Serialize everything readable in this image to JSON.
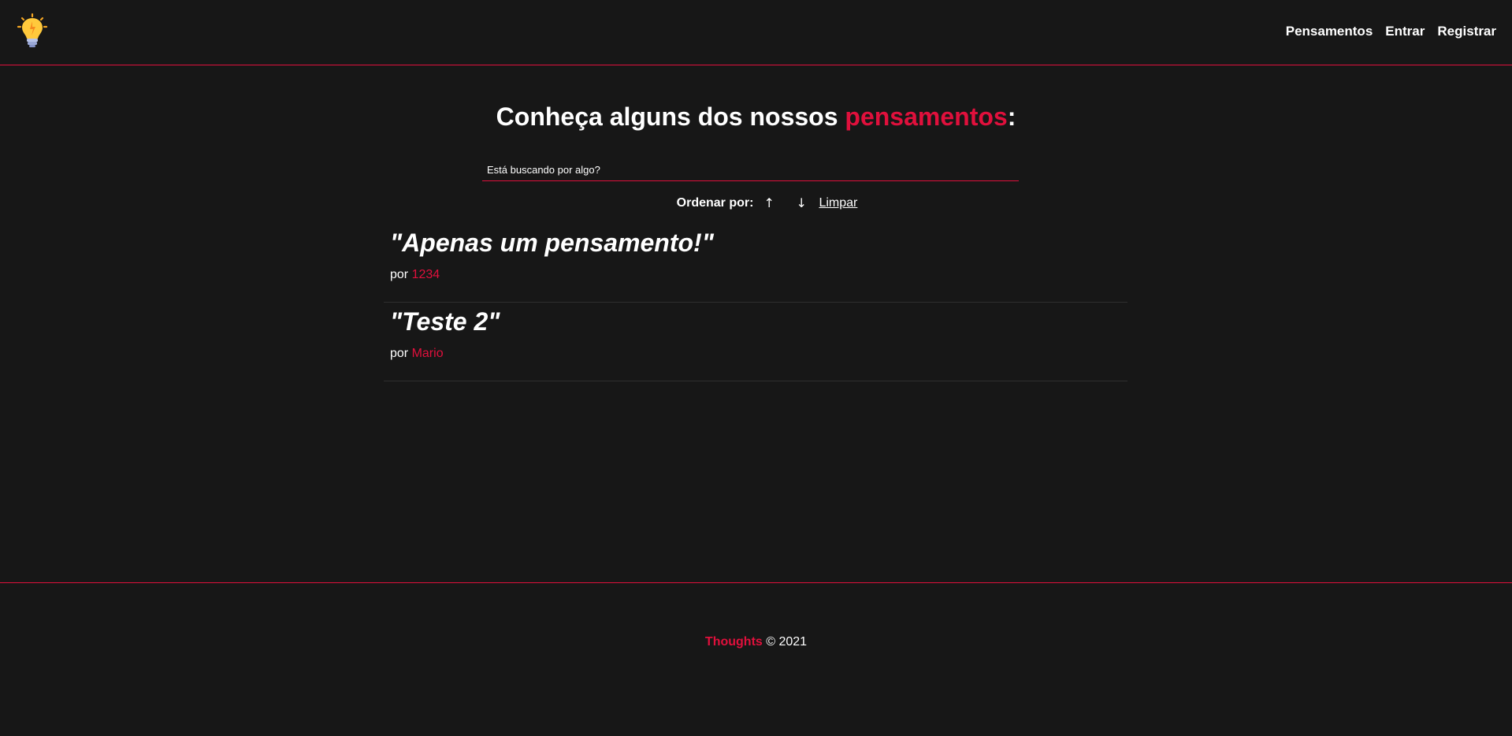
{
  "nav": {
    "logo_icon": "lightbulb-icon",
    "links": [
      "Pensamentos",
      "Entrar",
      "Registrar"
    ]
  },
  "headline": {
    "before": "Conheça alguns dos nossos",
    "highlight": "pensamentos",
    "after": ":"
  },
  "search": {
    "placeholder": "Está buscando por algo?",
    "value": ""
  },
  "order": {
    "label": "Ordenar por:",
    "asc_icon": "↑",
    "desc_icon": "↓",
    "clear_label": "Limpar"
  },
  "thoughts": [
    {
      "text": "\"Apenas um pensamento!\"",
      "by_label": "por",
      "author": "1234"
    },
    {
      "text": "\"Teste 2\"",
      "by_label": "por",
      "author": "Mario"
    }
  ],
  "footer": {
    "brand": "Thoughts",
    "copyright": "© 2021"
  },
  "colors": {
    "background": "#171717",
    "accent": "#e0103c",
    "text": "#ffffff"
  }
}
